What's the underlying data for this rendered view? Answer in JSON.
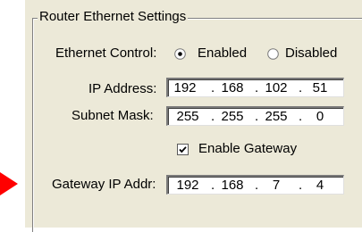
{
  "group": {
    "title": "Router Ethernet Settings"
  },
  "ethernet_control": {
    "label": "Ethernet Control:",
    "options": [
      "Enabled",
      "Disabled"
    ],
    "selected": "Enabled"
  },
  "ip_address": {
    "label": "IP Address:",
    "octets": [
      "192",
      "168",
      "102",
      "51"
    ]
  },
  "subnet_mask": {
    "label": "Subnet Mask:",
    "octets": [
      "255",
      "255",
      "255",
      "0"
    ]
  },
  "enable_gateway": {
    "label": "Enable Gateway",
    "checked": true
  },
  "gateway_ip": {
    "label": "Gateway IP Addr:",
    "octets": [
      "192",
      "168",
      "7",
      "4"
    ]
  },
  "separator": ".",
  "colors": {
    "panel": "#ece9d8",
    "arrow": "#ff0000"
  }
}
